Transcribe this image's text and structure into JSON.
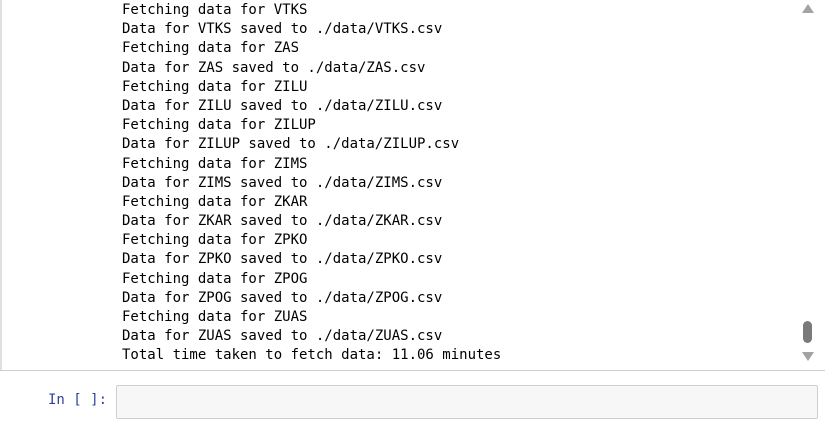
{
  "output": {
    "lines": [
      "Fetching data for VTKS",
      "Data for VTKS saved to ./data/VTKS.csv",
      "Fetching data for ZAS",
      "Data for ZAS saved to ./data/ZAS.csv",
      "Fetching data for ZILU",
      "Data for ZILU saved to ./data/ZILU.csv",
      "Fetching data for ZILUP",
      "Data for ZILUP saved to ./data/ZILUP.csv",
      "Fetching data for ZIMS",
      "Data for ZIMS saved to ./data/ZIMS.csv",
      "Fetching data for ZKAR",
      "Data for ZKAR saved to ./data/ZKAR.csv",
      "Fetching data for ZPKO",
      "Data for ZPKO saved to ./data/ZPKO.csv",
      "Fetching data for ZPOG",
      "Data for ZPOG saved to ./data/ZPOG.csv",
      "Fetching data for ZUAS",
      "Data for ZUAS saved to ./data/ZUAS.csv",
      "Total time taken to fetch data: 11.06 minutes"
    ]
  },
  "cell": {
    "prompt": "In [ ]:",
    "code": ""
  },
  "icons": {
    "scroll_up": "triangle-up",
    "scroll_down": "triangle-down"
  }
}
